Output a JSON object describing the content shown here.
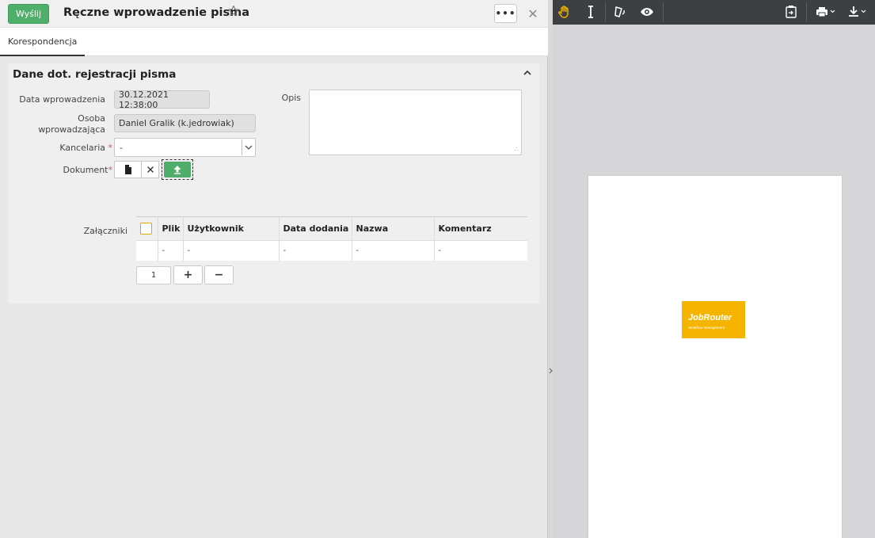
{
  "header": {
    "send_label": "Wyślij",
    "title": "Ręczne wprowadzenie pisma",
    "more_label": "•••",
    "close_label": "✕"
  },
  "tabs": [
    {
      "label": "Korespondencja",
      "active": true
    }
  ],
  "section": {
    "title": "Dane dot. rejestracji pisma",
    "fields": {
      "entry_date_label": "Data wprowadzenia",
      "entry_date_value": "30.12.2021 12:38:00",
      "person_label_line1": "Osoba",
      "person_label_line2": "wprowadzająca",
      "person_value": "Daniel Gralik (k.jedrowiak)",
      "office_label": "Kancelaria",
      "office_value": "-",
      "document_label": "Dokument",
      "description_label": "Opis",
      "required_mark": "*"
    },
    "attachments": {
      "label": "Załączniki",
      "columns": [
        "Plik",
        "Użytkownik",
        "Data dodania",
        "Nazwa",
        "Komentarz"
      ],
      "rows": [
        [
          "-",
          "-",
          "-",
          "-",
          "-"
        ]
      ],
      "page_value": "1",
      "add_label": "+",
      "remove_label": "−"
    }
  },
  "viewer": {
    "logo_name": "JobRouter",
    "logo_tagline": "Workflow Management",
    "colors": {
      "toolbar": "#3c4043",
      "accent_icon": "#f4b400",
      "logo_bg": "#f4b400"
    }
  },
  "colors": {
    "send_button": "#4faf6a",
    "required": "#d9534f"
  }
}
